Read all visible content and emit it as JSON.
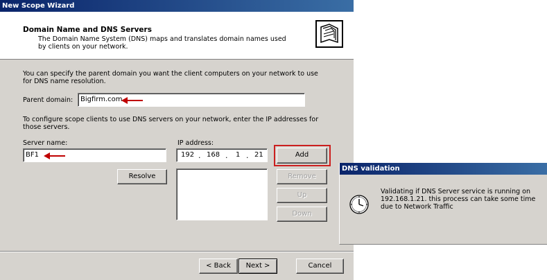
{
  "wizard": {
    "title": "New Scope Wizard",
    "header": {
      "title": "Domain Name and DNS Servers",
      "description": "The Domain Name System (DNS) maps and translates domain names used by clients on your network."
    },
    "intro_text": "You can specify the parent domain you want the client computers on your network to use for DNS name resolution.",
    "parent_domain": {
      "label": "Parent domain:",
      "value": "Bigfirm.com"
    },
    "dns_text": "To configure scope clients to use DNS servers on your network, enter the IP addresses for those servers.",
    "server_name": {
      "label": "Server name:",
      "value": "BF1"
    },
    "ip_address": {
      "label": "IP address:",
      "octets": [
        "192",
        "168",
        "1",
        "21"
      ]
    },
    "buttons": {
      "resolve": "Resolve",
      "add": "Add",
      "remove": "Remove",
      "up": "Up",
      "down": "Down",
      "back": "< Back",
      "next": "Next >",
      "cancel": "Cancel"
    },
    "highlight_color": "#cc1f1f"
  },
  "dns_validation": {
    "title": "DNS validation",
    "message": "Validating if DNS Server service is running on 192.168.1.21. this process can take some time due to Network Traffic",
    "icon": "clock-icon"
  }
}
